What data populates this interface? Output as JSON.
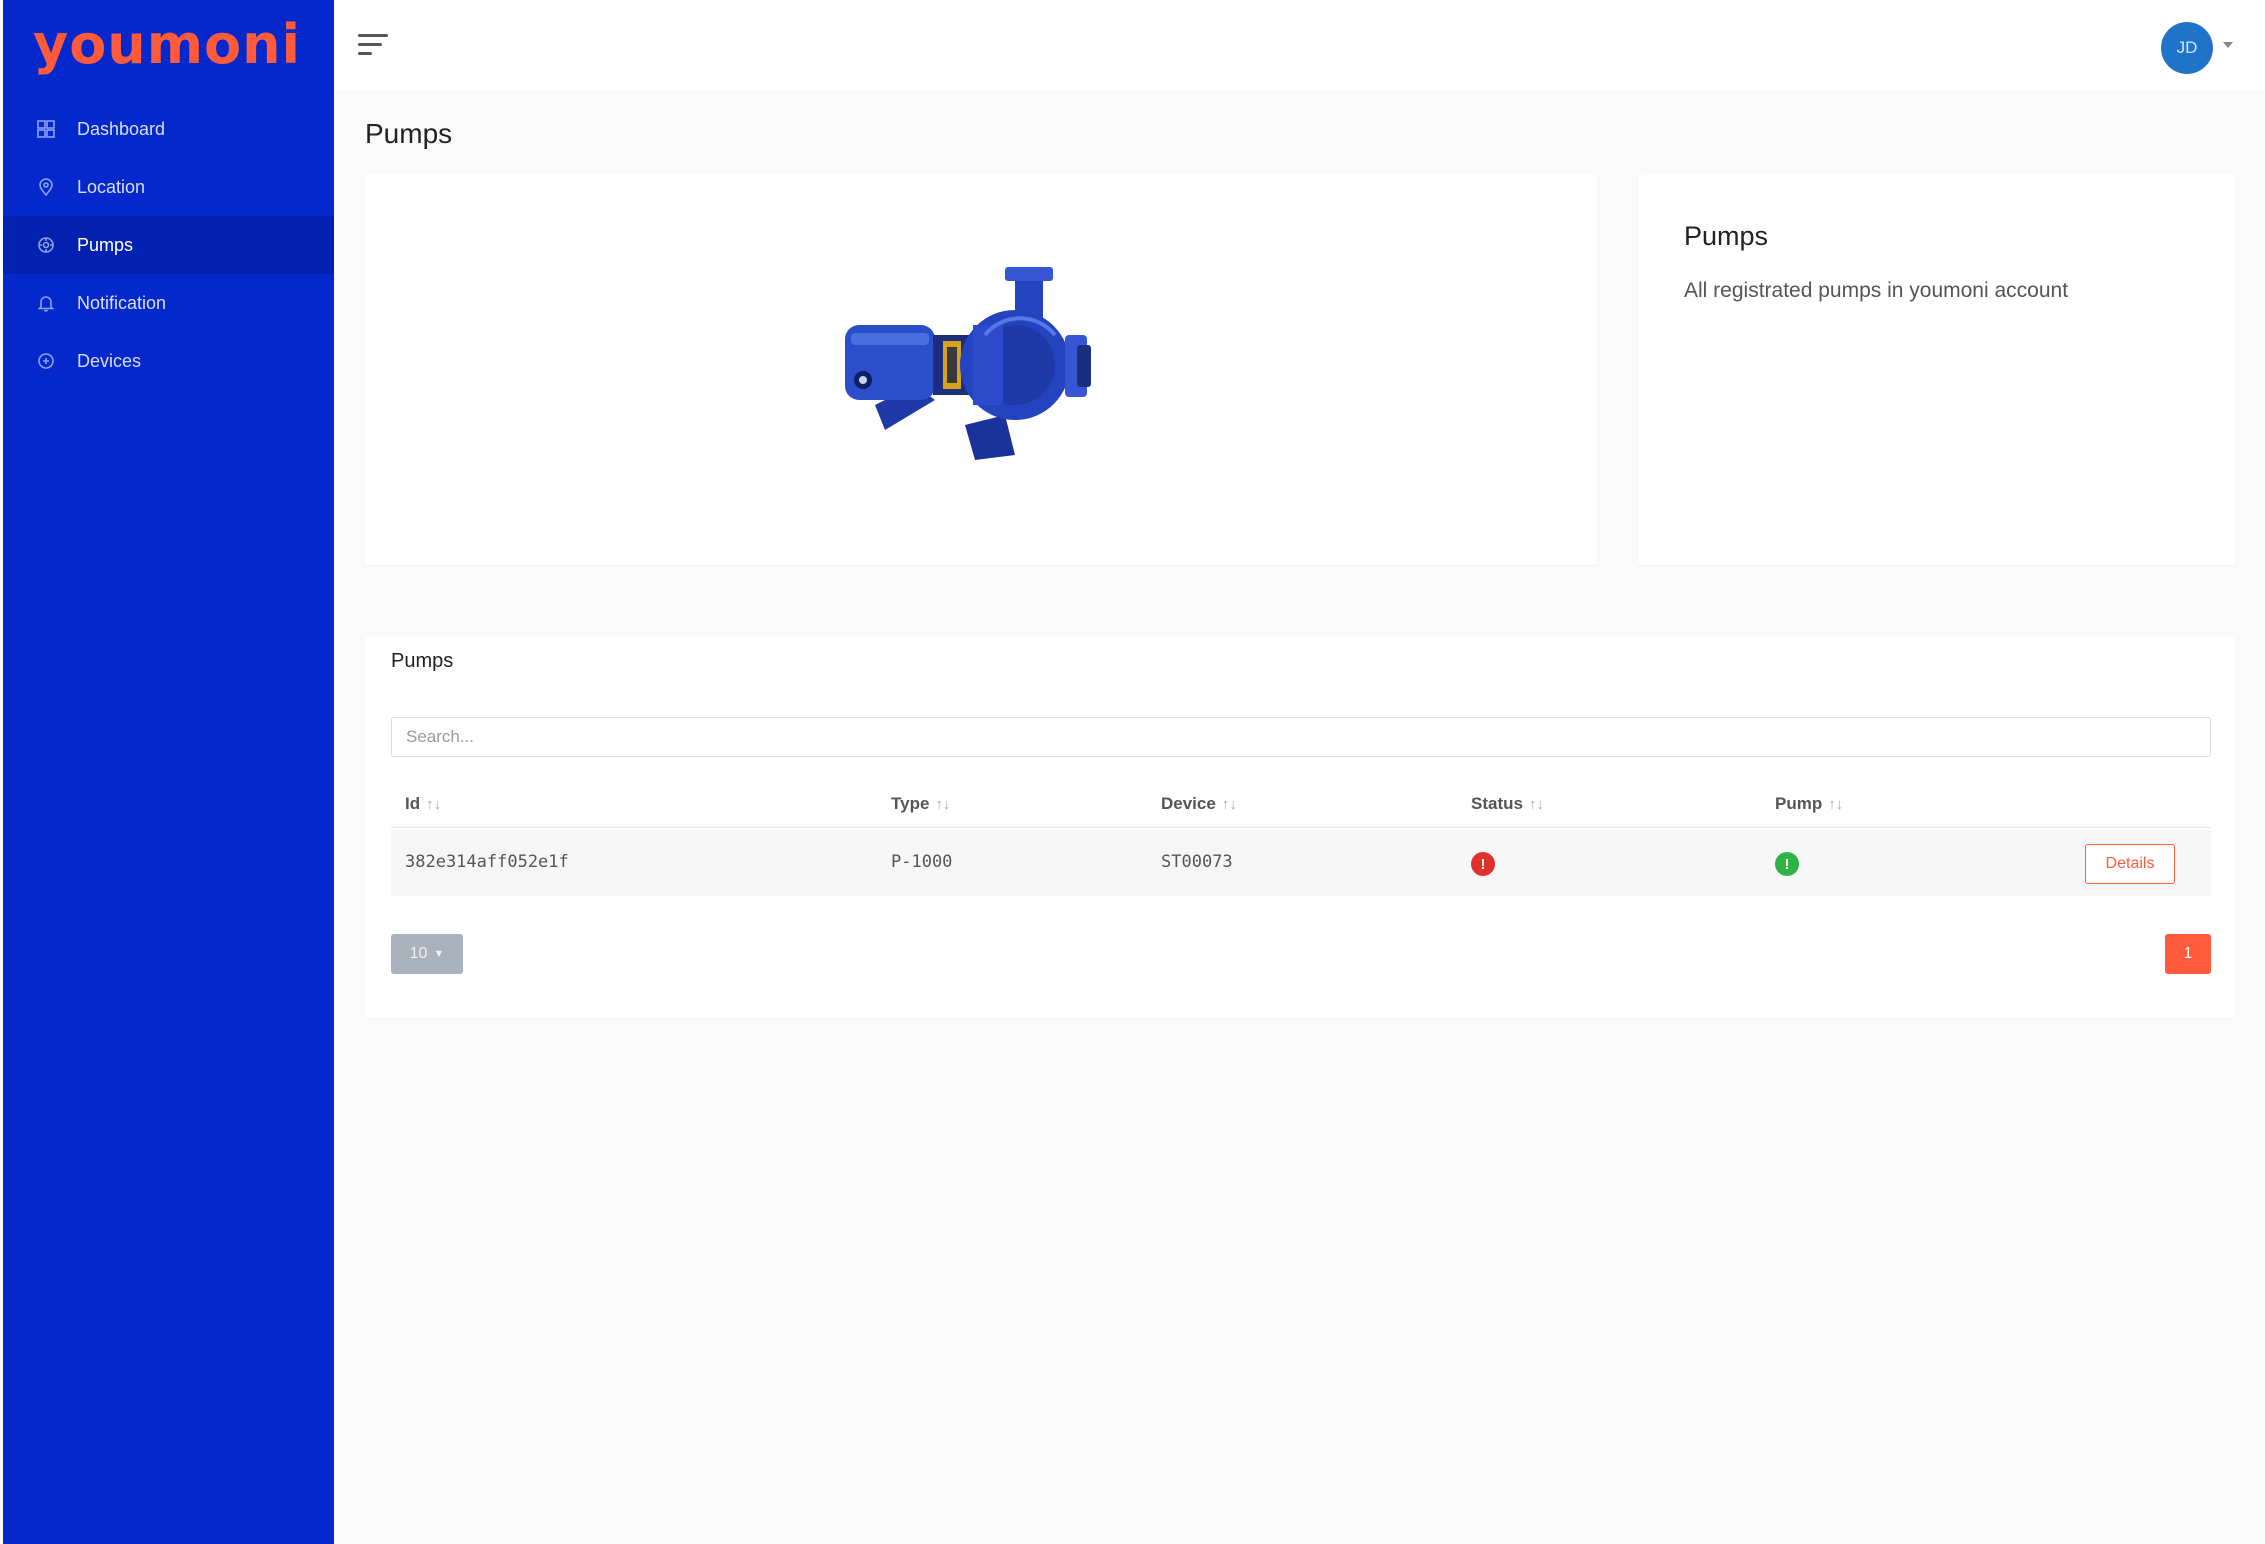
{
  "brand": {
    "logo_text": "youmoni",
    "logo_color": "#ff5a3c",
    "sidebar_color": "#0528cc"
  },
  "sidebar": {
    "items": [
      {
        "label": "Dashboard",
        "icon": "dashboard-icon",
        "active": false
      },
      {
        "label": "Location",
        "icon": "location-pin-icon",
        "active": false
      },
      {
        "label": "Pumps",
        "icon": "pump-icon",
        "active": true
      },
      {
        "label": "Notification",
        "icon": "bell-icon",
        "active": false
      },
      {
        "label": "Devices",
        "icon": "device-icon",
        "active": false
      }
    ]
  },
  "topbar": {
    "menu_icon": "hamburger-icon",
    "avatar_initials": "JD"
  },
  "page": {
    "title": "Pumps"
  },
  "info_card": {
    "title": "Pumps",
    "description": "All registrated pumps in youmoni account"
  },
  "table_card": {
    "title": "Pumps",
    "search_placeholder": "Search...",
    "sort_indicator": "↑↓",
    "columns": [
      "Id",
      "Type",
      "Device",
      "Status",
      "Pump"
    ],
    "rows": [
      {
        "id": "382e314aff052e1f",
        "type": "P-1000",
        "device": "ST00073",
        "status": "error",
        "status_color": "#e0322b",
        "pump": "ok",
        "pump_color": "#2fb344",
        "action": "Details"
      }
    ],
    "page_size": "10",
    "current_page": "1"
  }
}
